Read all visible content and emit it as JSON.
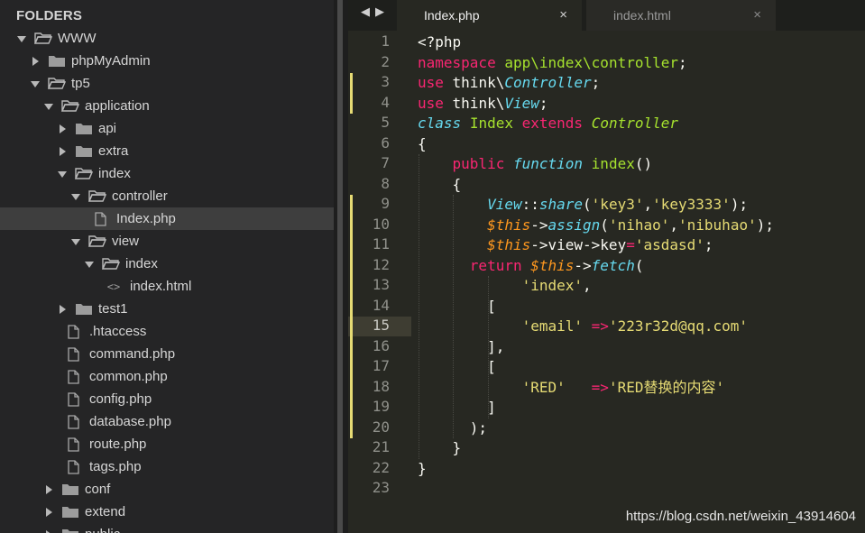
{
  "sidebar": {
    "title": "FOLDERS",
    "items": [
      {
        "label": "WWW",
        "depth": 0,
        "kind": "folder",
        "open": true
      },
      {
        "label": "phpMyAdmin",
        "depth": 1,
        "kind": "folder",
        "open": false
      },
      {
        "label": "tp5",
        "depth": 1,
        "kind": "folder",
        "open": true
      },
      {
        "label": "application",
        "depth": 2,
        "kind": "folder",
        "open": true
      },
      {
        "label": "api",
        "depth": 3,
        "kind": "folder",
        "open": false
      },
      {
        "label": "extra",
        "depth": 3,
        "kind": "folder",
        "open": false
      },
      {
        "label": "index",
        "depth": 3,
        "kind": "folder",
        "open": true
      },
      {
        "label": "controller",
        "depth": 4,
        "kind": "folder",
        "open": true
      },
      {
        "label": "Index.php",
        "depth": 5,
        "kind": "file",
        "selected": true
      },
      {
        "label": "view",
        "depth": 4,
        "kind": "folder",
        "open": true
      },
      {
        "label": "index",
        "depth": 5,
        "kind": "folder",
        "open": true
      },
      {
        "label": "index.html",
        "depth": 6,
        "kind": "code"
      },
      {
        "label": "test1",
        "depth": 3,
        "kind": "folder",
        "open": false
      },
      {
        "label": ".htaccess",
        "depth": 3,
        "kind": "file"
      },
      {
        "label": "command.php",
        "depth": 3,
        "kind": "file"
      },
      {
        "label": "common.php",
        "depth": 3,
        "kind": "file"
      },
      {
        "label": "config.php",
        "depth": 3,
        "kind": "file"
      },
      {
        "label": "database.php",
        "depth": 3,
        "kind": "file"
      },
      {
        "label": "route.php",
        "depth": 3,
        "kind": "file"
      },
      {
        "label": "tags.php",
        "depth": 3,
        "kind": "file"
      },
      {
        "label": "conf",
        "depth": 2,
        "kind": "folder",
        "open": false
      },
      {
        "label": "extend",
        "depth": 2,
        "kind": "folder",
        "open": false
      },
      {
        "label": "public",
        "depth": 2,
        "kind": "folder",
        "open": false
      }
    ]
  },
  "tabs": [
    {
      "label": "Index.php",
      "active": true,
      "close": "×"
    },
    {
      "label": "index.html",
      "active": false,
      "close": "×"
    }
  ],
  "nav": {
    "back": "◀",
    "forward": "▶"
  },
  "editor": {
    "current_line": 15,
    "modified_lines": [
      3,
      4,
      9,
      10,
      11,
      12,
      13,
      14,
      15,
      16,
      17,
      18,
      19,
      20
    ],
    "lines": [
      [
        [
          "w",
          "<?php"
        ]
      ],
      [
        [
          "k",
          "namespace"
        ],
        [
          "w",
          " "
        ],
        [
          "g",
          "app\\index\\controller"
        ],
        [
          "w",
          ";"
        ]
      ],
      [
        [
          "k",
          "use"
        ],
        [
          "w",
          " think\\"
        ],
        [
          "i",
          "Controller"
        ],
        [
          "w",
          ";"
        ]
      ],
      [
        [
          "k",
          "use"
        ],
        [
          "w",
          " think\\"
        ],
        [
          "i",
          "View"
        ],
        [
          "w",
          ";"
        ]
      ],
      [
        [
          "i",
          "class"
        ],
        [
          "w",
          " "
        ],
        [
          "g",
          "Index"
        ],
        [
          "w",
          " "
        ],
        [
          "k",
          "extends"
        ],
        [
          "w",
          " "
        ],
        [
          "gi",
          "Controller"
        ]
      ],
      [
        [
          "w",
          "{"
        ]
      ],
      [
        [
          "w",
          "    "
        ],
        [
          "k",
          "public"
        ],
        [
          "w",
          " "
        ],
        [
          "i",
          "function"
        ],
        [
          "w",
          " "
        ],
        [
          "g",
          "index"
        ],
        [
          "w",
          "()"
        ]
      ],
      [
        [
          "w",
          "    {"
        ]
      ],
      [
        [
          "w",
          "        "
        ],
        [
          "i",
          "View"
        ],
        [
          "w",
          "::"
        ],
        [
          "i",
          "share"
        ],
        [
          "w",
          "("
        ],
        [
          "s",
          "'key3'"
        ],
        [
          "w",
          ","
        ],
        [
          "s",
          "'key3333'"
        ],
        [
          "w",
          ");"
        ]
      ],
      [
        [
          "w",
          "        "
        ],
        [
          "v",
          "$this"
        ],
        [
          "w",
          "->"
        ],
        [
          "i",
          "assign"
        ],
        [
          "w",
          "("
        ],
        [
          "s",
          "'nihao'"
        ],
        [
          "w",
          ","
        ],
        [
          "s",
          "'nibuhao'"
        ],
        [
          "w",
          ");"
        ]
      ],
      [
        [
          "w",
          "        "
        ],
        [
          "v",
          "$this"
        ],
        [
          "w",
          "->view->key"
        ],
        [
          "k",
          "="
        ],
        [
          "s",
          "'asdasd'"
        ],
        [
          "w",
          ";"
        ]
      ],
      [
        [
          "w",
          "      "
        ],
        [
          "k",
          "return"
        ],
        [
          "w",
          " "
        ],
        [
          "v",
          "$this"
        ],
        [
          "w",
          "->"
        ],
        [
          "i",
          "fetch"
        ],
        [
          "w",
          "("
        ]
      ],
      [
        [
          "w",
          "            "
        ],
        [
          "s",
          "'index'"
        ],
        [
          "w",
          ","
        ]
      ],
      [
        [
          "w",
          "        ["
        ]
      ],
      [
        [
          "w",
          "            "
        ],
        [
          "s",
          "'email'"
        ],
        [
          "w",
          " "
        ],
        [
          "k",
          "=>"
        ],
        [
          "s",
          "'223r32d@qq.com'"
        ]
      ],
      [
        [
          "w",
          "        ],"
        ]
      ],
      [
        [
          "w",
          "        ["
        ]
      ],
      [
        [
          "w",
          "            "
        ],
        [
          "s",
          "'RED'"
        ],
        [
          "w",
          "   "
        ],
        [
          "k",
          "=>"
        ],
        [
          "s",
          "'RED替换的内容'"
        ]
      ],
      [
        [
          "w",
          "        ]"
        ]
      ],
      [
        [
          "w",
          "      );"
        ]
      ],
      [
        [
          "w",
          "    }"
        ]
      ],
      [
        [
          "w",
          "}"
        ]
      ],
      [
        [
          "w",
          ""
        ]
      ]
    ]
  },
  "watermark": "https://blog.csdn.net/weixin_43914604",
  "colors": {
    "keyword": "#f92672",
    "string": "#e6db74",
    "type": "#66d9ef",
    "function": "#a6e22e",
    "variable": "#fd971f",
    "background": "#272822"
  }
}
